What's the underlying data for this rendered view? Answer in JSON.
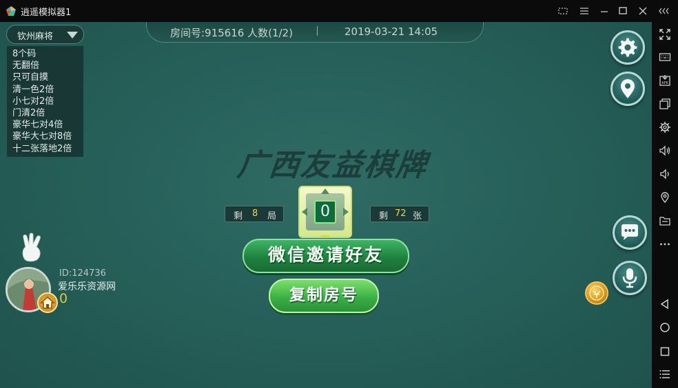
{
  "window": {
    "title": "逍遥模拟器1",
    "controls": [
      "screen-icon",
      "menu-icon",
      "minimize-icon",
      "maximize-icon",
      "close-icon",
      "collapse-icon"
    ]
  },
  "side_toolbar": {
    "buttons": [
      "fullscreen-icon",
      "keyboard-icon",
      "apk-install-icon",
      "multi-window-icon",
      "settings-gear-icon",
      "volume-up-icon",
      "volume-down-icon",
      "location-icon",
      "folder-icon",
      "more-icon",
      "back-icon",
      "home-icon",
      "recents-icon",
      "list-icon"
    ]
  },
  "room": {
    "info": "房间号:915616  人数(1/2)",
    "datetime": "2019-03-21 14:05"
  },
  "rules": {
    "game_type": "钦州麻将",
    "items": [
      "8个码",
      "无翻倍",
      "只可自摸",
      "清一色2倍",
      "小七对2倍",
      "门清2倍",
      "豪华七对4倍",
      "豪华大七对8倍",
      "十二张落地2倍"
    ]
  },
  "logo": {
    "text": "广西友益棋牌"
  },
  "counters": {
    "rounds": {
      "prefix": "剩",
      "value": "8",
      "suffix": "局"
    },
    "tiles": {
      "prefix": "剩",
      "value": "72",
      "suffix": "张"
    }
  },
  "center": {
    "value": "0"
  },
  "buttons": {
    "invite": "微信邀请好友",
    "copy_room": "复制房号"
  },
  "player": {
    "id": "ID:124736",
    "name": "爱乐乐资源网",
    "score": "0"
  },
  "colors": {
    "table_green": "#27605a",
    "invite_green": "#1f8240",
    "copy_green": "#3bb146",
    "score_gold": "#e6c43c"
  }
}
